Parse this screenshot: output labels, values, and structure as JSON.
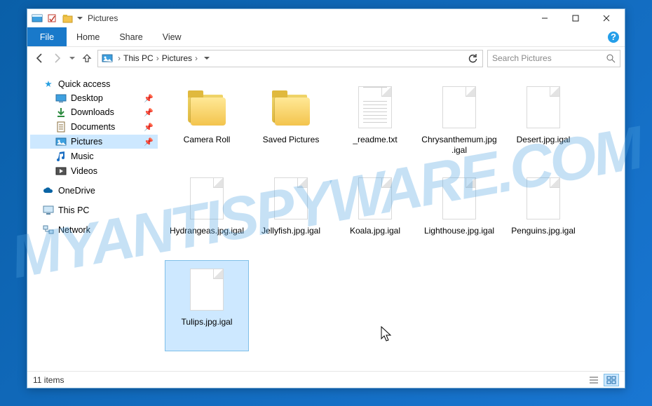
{
  "titlebar": {
    "title": "Pictures"
  },
  "ribbon": {
    "file": "File",
    "tabs": [
      "Home",
      "Share",
      "View"
    ]
  },
  "breadcrumb": {
    "root": "This PC",
    "current": "Pictures"
  },
  "search": {
    "placeholder": "Search Pictures"
  },
  "sidebar": {
    "quick_access": {
      "label": "Quick access",
      "items": [
        {
          "label": "Desktop",
          "pinned": true
        },
        {
          "label": "Downloads",
          "pinned": true
        },
        {
          "label": "Documents",
          "pinned": true
        },
        {
          "label": "Pictures",
          "pinned": true,
          "selected": true
        },
        {
          "label": "Music",
          "pinned": false
        },
        {
          "label": "Videos",
          "pinned": false
        }
      ]
    },
    "onedrive": {
      "label": "OneDrive"
    },
    "thispc": {
      "label": "This PC"
    },
    "network": {
      "label": "Network"
    }
  },
  "files": [
    {
      "name": "Camera Roll",
      "kind": "folder"
    },
    {
      "name": "Saved Pictures",
      "kind": "folder"
    },
    {
      "name": "_readme.txt",
      "kind": "text"
    },
    {
      "name": "Chrysanthemum.jpg.igal",
      "kind": "unknown"
    },
    {
      "name": "Desert.jpg.igal",
      "kind": "unknown"
    },
    {
      "name": "Hydrangeas.jpg.igal",
      "kind": "unknown"
    },
    {
      "name": "Jellyfish.jpg.igal",
      "kind": "unknown"
    },
    {
      "name": "Koala.jpg.igal",
      "kind": "unknown"
    },
    {
      "name": "Lighthouse.jpg.igal",
      "kind": "unknown"
    },
    {
      "name": "Penguins.jpg.igal",
      "kind": "unknown"
    },
    {
      "name": "Tulips.jpg.igal",
      "kind": "unknown",
      "selected": true
    }
  ],
  "status": {
    "count_label": "11 items"
  },
  "watermark": "MYANTISPYWARE.COM"
}
